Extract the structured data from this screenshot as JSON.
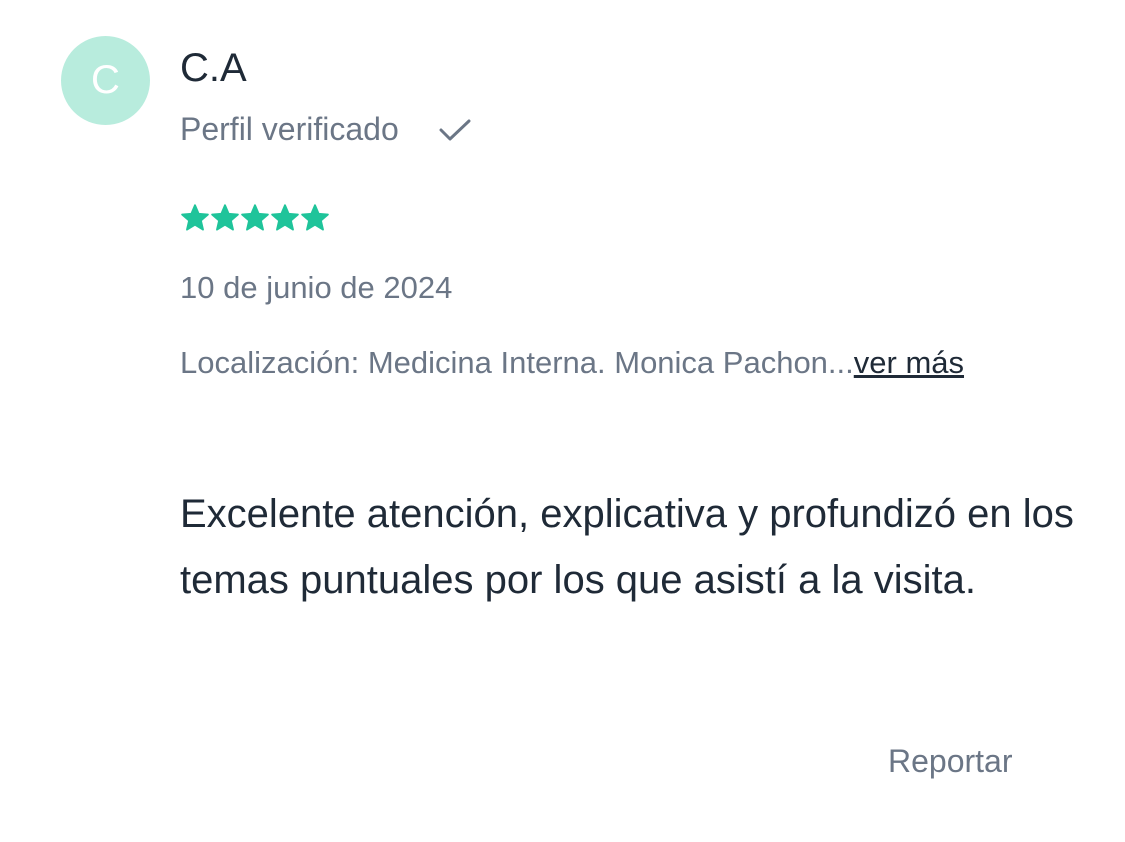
{
  "review": {
    "avatar_initial": "C",
    "author": "C.A",
    "verified_label": "Perfil verificado",
    "rating": 5,
    "rating_max": 5,
    "date": "10 de junio de 2024",
    "location_text": "Localización: Medicina Interna. Monica Pachon...",
    "see_more_label": "ver más",
    "body": "Excelente atención, explicativa y profundizó en los temas puntuales por los que asistí a la visita.",
    "report_label": "Reportar"
  },
  "colors": {
    "avatar_bg": "#b8ecdd",
    "star": "#1fc49a",
    "muted_text": "#6b7686",
    "main_text": "#1f2a37"
  },
  "icons": {
    "verified": "check-icon",
    "rating": "star-icon"
  }
}
